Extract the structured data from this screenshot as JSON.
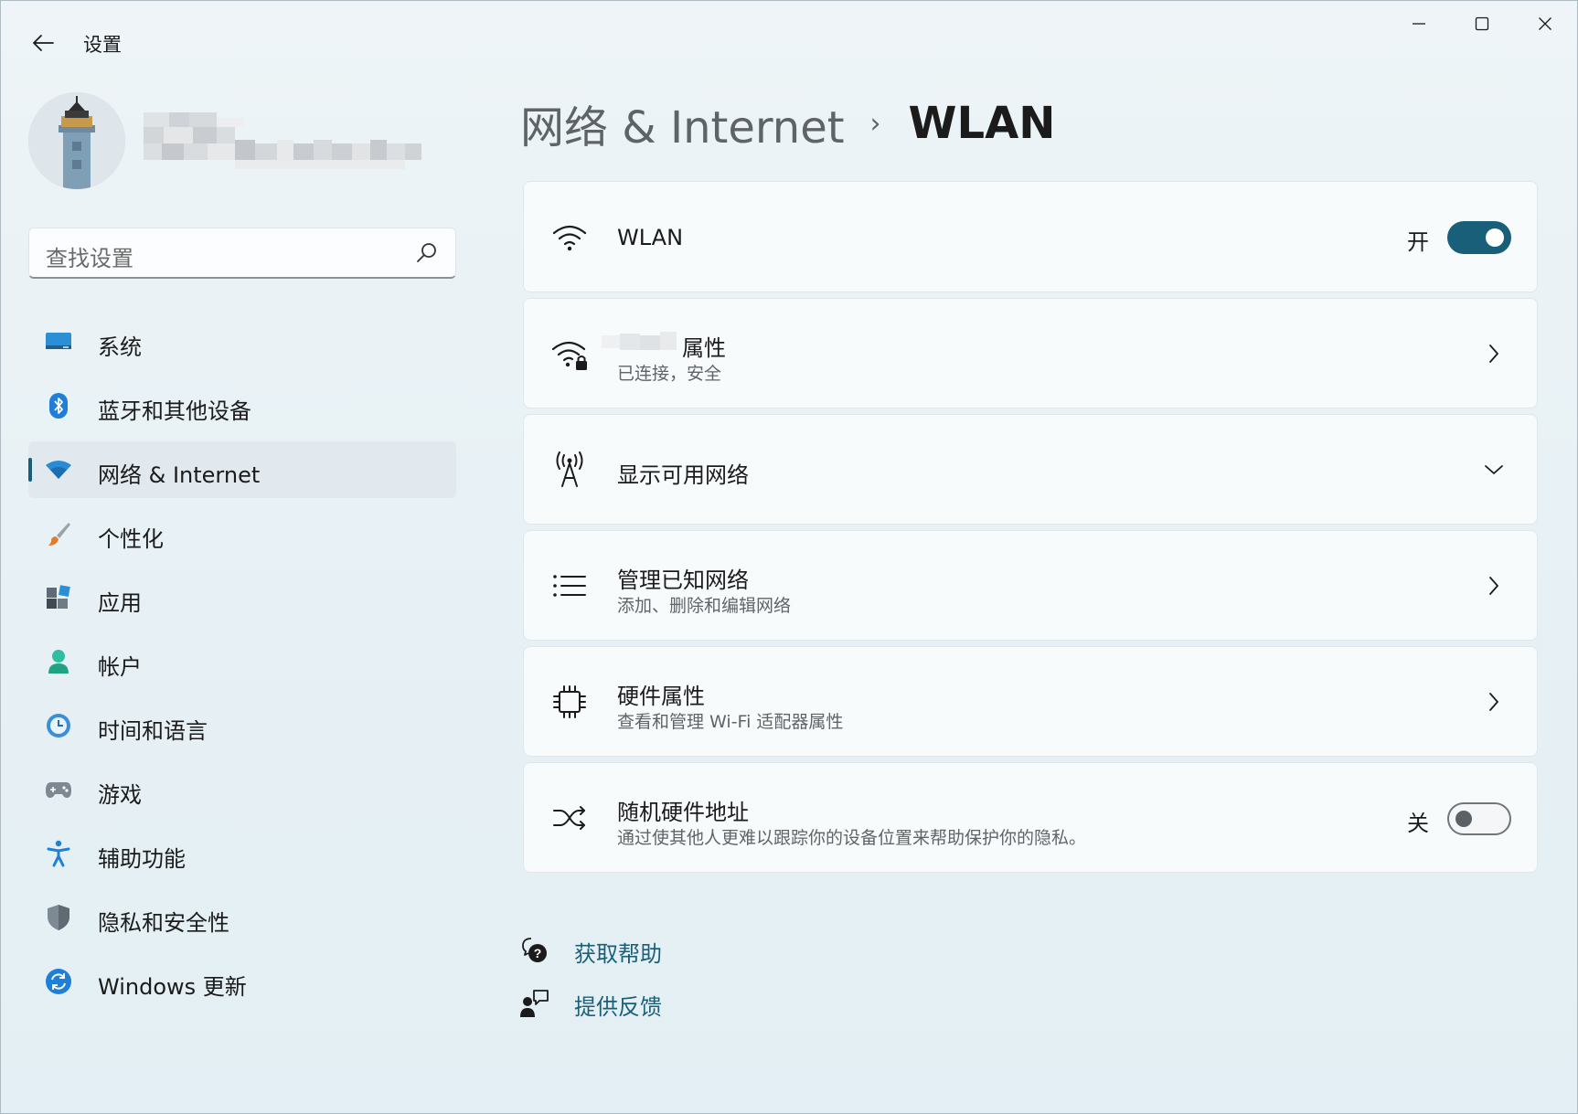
{
  "window": {
    "app_title": "设置"
  },
  "user": {
    "name": ""
  },
  "search": {
    "placeholder": "查找设置"
  },
  "sidebar": {
    "items": [
      {
        "label": "系统",
        "icon": "system-icon",
        "active": false
      },
      {
        "label": "蓝牙和其他设备",
        "icon": "bluetooth-icon",
        "active": false
      },
      {
        "label": "网络 & Internet",
        "icon": "wifi-icon",
        "active": true
      },
      {
        "label": "个性化",
        "icon": "brush-icon",
        "active": false
      },
      {
        "label": "应用",
        "icon": "apps-icon",
        "active": false
      },
      {
        "label": "帐户",
        "icon": "account-icon",
        "active": false
      },
      {
        "label": "时间和语言",
        "icon": "time-language-icon",
        "active": false
      },
      {
        "label": "游戏",
        "icon": "gamepad-icon",
        "active": false
      },
      {
        "label": "辅助功能",
        "icon": "accessibility-icon",
        "active": false
      },
      {
        "label": "隐私和安全性",
        "icon": "shield-icon",
        "active": false
      },
      {
        "label": "Windows 更新",
        "icon": "update-icon",
        "active": false
      }
    ]
  },
  "breadcrumb": {
    "parent": "网络 & Internet",
    "separator": "›",
    "current": "WLAN"
  },
  "cards": {
    "wlan": {
      "title": "WLAN",
      "state_label": "开",
      "on": true
    },
    "properties": {
      "title_suffix": "属性",
      "subtitle": "已连接，安全"
    },
    "available": {
      "title": "显示可用网络"
    },
    "known": {
      "title": "管理已知网络",
      "subtitle": "添加、删除和编辑网络"
    },
    "hardware": {
      "title": "硬件属性",
      "subtitle": "查看和管理 Wi-Fi 适配器属性"
    },
    "random_mac": {
      "title": "随机硬件地址",
      "subtitle": "通过使其他人更难以跟踪你的设备位置来帮助保护你的隐私。",
      "state_label": "关",
      "on": false
    }
  },
  "help": {
    "get_help": "获取帮助",
    "feedback": "提供反馈"
  },
  "colors": {
    "accent": "#1a5f7a",
    "background": "#e8f1f5",
    "card": "#f8fbfc"
  }
}
